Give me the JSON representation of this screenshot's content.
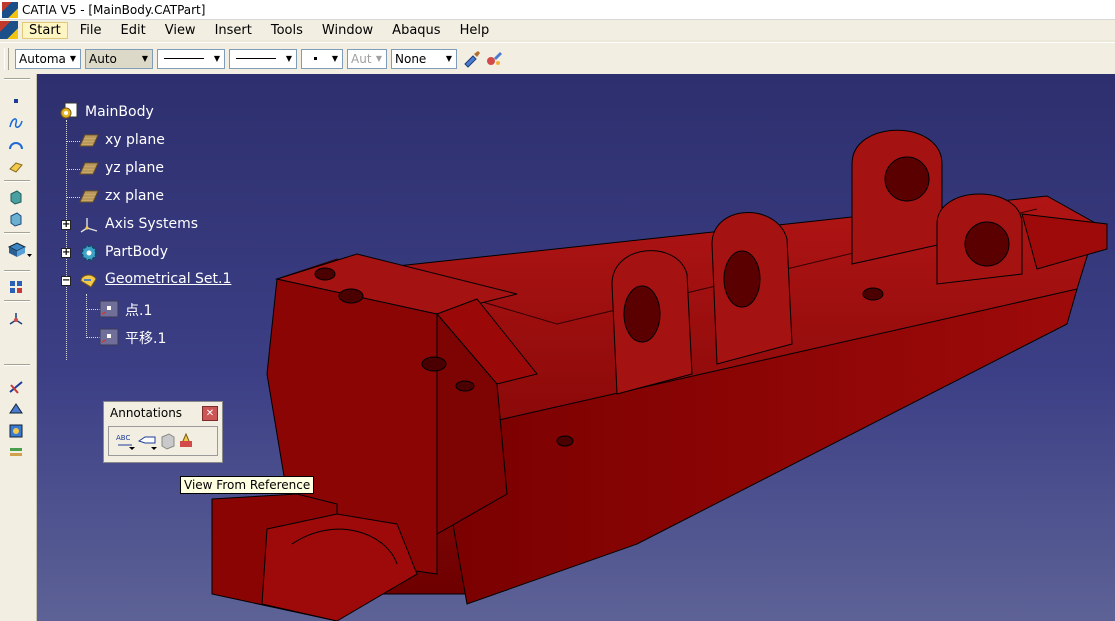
{
  "window": {
    "title": "CATIA V5 - [MainBody.CATPart]"
  },
  "menu": {
    "items": [
      {
        "label": "Start"
      },
      {
        "label": "File"
      },
      {
        "label": "Edit"
      },
      {
        "label": "View"
      },
      {
        "label": "Insert"
      },
      {
        "label": "Tools"
      },
      {
        "label": "Window"
      },
      {
        "label": "Abaqus"
      },
      {
        "label": "Help"
      }
    ]
  },
  "toolbar": {
    "fill_color": "Automa",
    "line_color": "Auto",
    "line_type": "",
    "line_thickness": "",
    "point_type": "",
    "layer_auto": "Aut",
    "layer": "None"
  },
  "tree": {
    "root": "MainBody",
    "items": [
      {
        "label": "xy plane",
        "icon": "plane-icon"
      },
      {
        "label": "yz plane",
        "icon": "plane-icon"
      },
      {
        "label": "zx plane",
        "icon": "plane-icon"
      },
      {
        "label": "Axis Systems",
        "icon": "axis-icon"
      },
      {
        "label": "PartBody",
        "icon": "gear-icon"
      },
      {
        "label": "Geometrical Set.1",
        "icon": "geometrical-set-icon"
      }
    ],
    "children": [
      {
        "label": "点.1",
        "icon": "point-icon"
      },
      {
        "label": "平移.1",
        "icon": "translate-icon"
      }
    ]
  },
  "annotations_toolbar": {
    "title": "Annotations"
  },
  "tooltip": {
    "text": "View From Reference"
  },
  "colors": {
    "background_top": "#2d2f6e",
    "background_bottom": "#5d6296",
    "part_color": "#8b0000",
    "menu_active": "#fdf6c3"
  }
}
